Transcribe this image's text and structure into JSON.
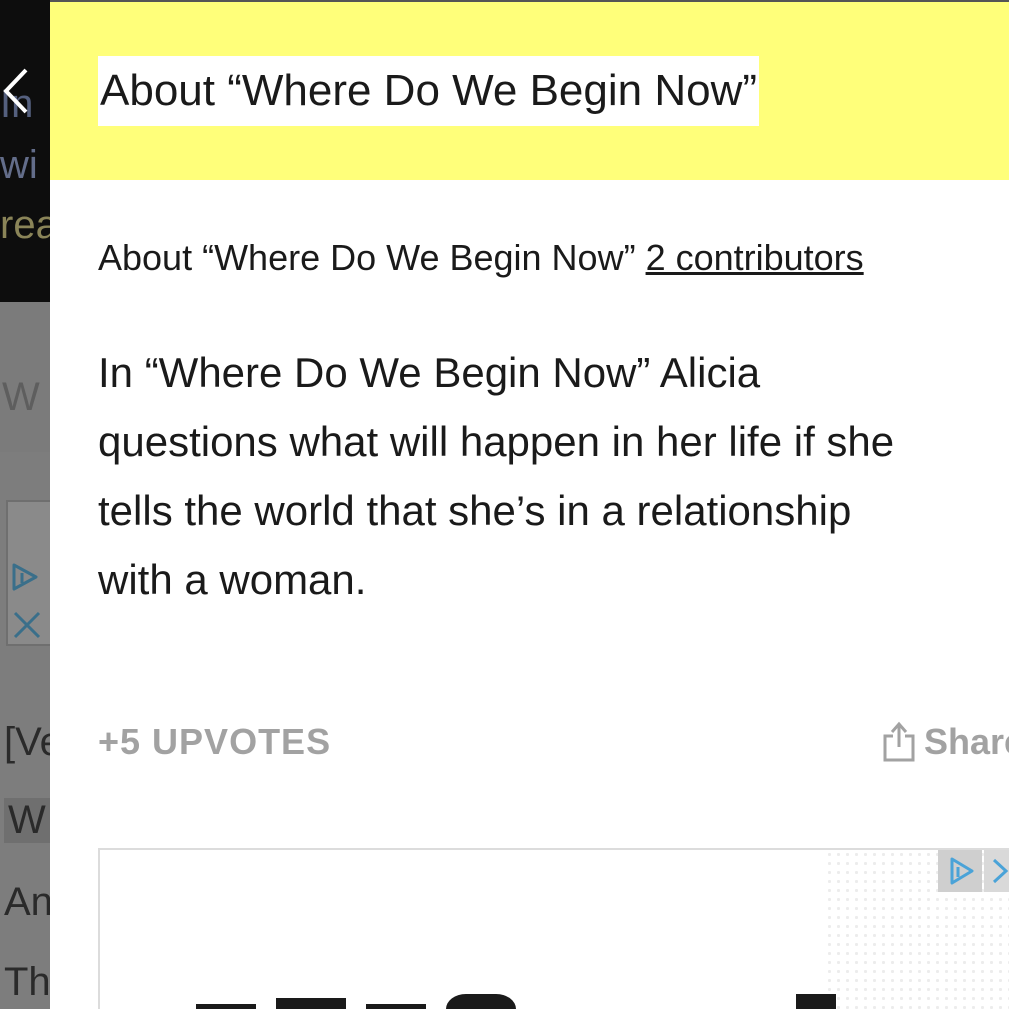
{
  "background_page": {
    "top_lines": [
      "In",
      "wi",
      "rea"
    ],
    "section_fragment": "W",
    "lyric_fragments": [
      "[Ve",
      "W",
      "An",
      "Th"
    ]
  },
  "panel": {
    "header_title": "About “Where Do We Begin Now”",
    "about_label": "About “Where Do We Begin Now”",
    "contributors_link": "2 contributors",
    "body_lines": [
      "In “Where Do We Begin Now” Alicia",
      "questions what will happen in her life if she",
      "tells the world that she’s in a relationship",
      "with a woman."
    ],
    "upvotes_label": "+5 UPVOTES",
    "share_label": "Share"
  },
  "colors": {
    "header_background": "#ffff7a",
    "muted_text": "#a2a2a2",
    "body_text": "#1a1a1a"
  },
  "icons": [
    "back-arrow-icon",
    "ad-choices-icon",
    "close-icon",
    "share-icon"
  ]
}
